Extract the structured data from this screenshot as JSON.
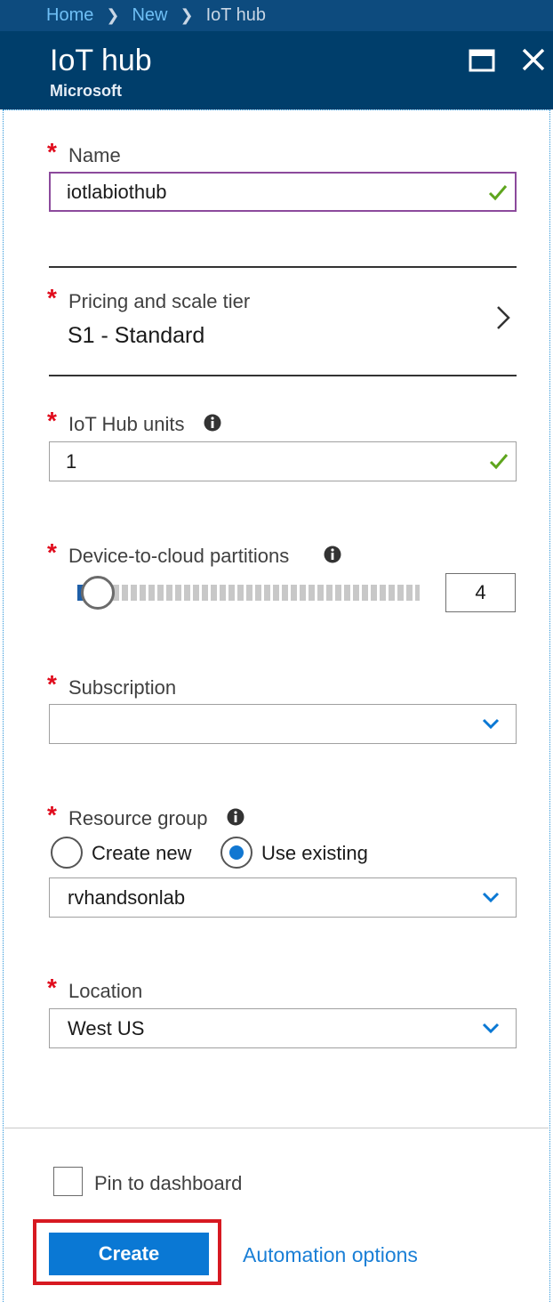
{
  "breadcrumb": {
    "items": [
      "Home",
      "New"
    ],
    "current": "IoT hub",
    "separator": ">"
  },
  "header": {
    "title": "IoT hub",
    "subtitle": "Microsoft",
    "maximize_icon": "maximize-icon",
    "close_icon": "close-icon"
  },
  "form": {
    "required_mark": "*",
    "name": {
      "label": "Name",
      "value": "iotlabiothub",
      "valid": true
    },
    "pricing": {
      "label": "Pricing and scale tier",
      "value": "S1 - Standard"
    },
    "units": {
      "label": "IoT Hub units",
      "value": "1",
      "valid": true
    },
    "partitions": {
      "label": "Device-to-cloud partitions",
      "value": "4",
      "slider_fraction": 0.0
    },
    "subscription": {
      "label": "Subscription",
      "value": ""
    },
    "resource_group": {
      "label": "Resource group",
      "options": [
        "Create new",
        "Use existing"
      ],
      "selected": "Use existing",
      "value": "rvhandsonlab"
    },
    "location": {
      "label": "Location",
      "value": "West US"
    }
  },
  "footer": {
    "pin_label": "Pin to dashboard",
    "pin_checked": false,
    "create_label": "Create",
    "automation_label": "Automation options"
  },
  "colors": {
    "header_bg": "#003e6b",
    "breadcrumb_bg": "#0d4b7e",
    "required": "#e00b1c",
    "accent": "#0a78d4",
    "valid_check": "#5ea51d",
    "highlight": "#d71921"
  }
}
